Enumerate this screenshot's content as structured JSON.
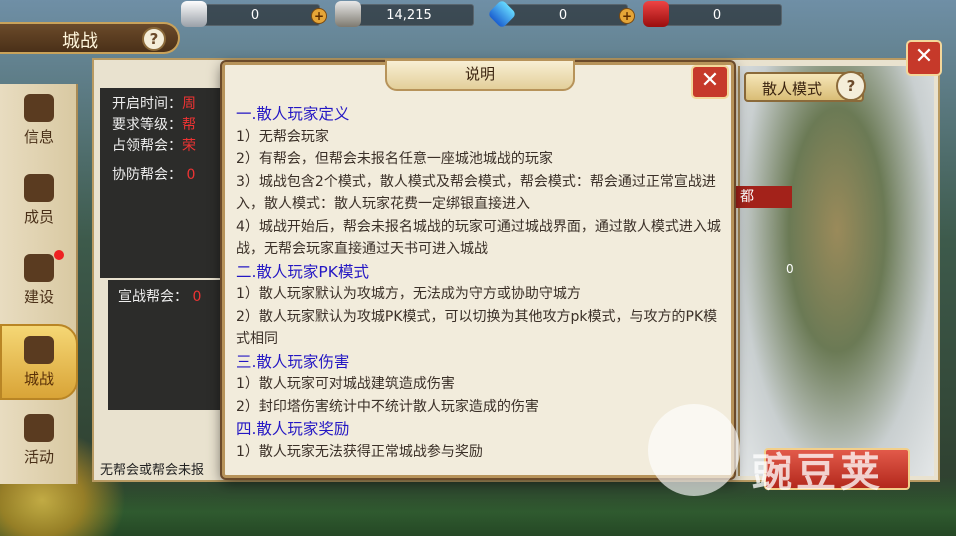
{
  "resources": [
    {
      "icon": "silver-ingot-icon",
      "value": "0",
      "has_plus": true
    },
    {
      "icon": "locked-ingot-icon",
      "value": "14,215",
      "has_plus": false
    },
    {
      "icon": "diamond-icon",
      "value": "0",
      "has_plus": true
    },
    {
      "icon": "fortune-ticket-icon",
      "value": "0",
      "has_plus": false
    }
  ],
  "header": {
    "title": "城战",
    "help": "?"
  },
  "sidebar": {
    "items": [
      {
        "label": "信息",
        "icon": "info-icon",
        "active": false
      },
      {
        "label": "成员",
        "icon": "members-icon",
        "active": false
      },
      {
        "label": "建设",
        "icon": "hammer-icon",
        "active": false,
        "badge": true
      },
      {
        "label": "城战",
        "icon": "castle-icon",
        "active": true
      },
      {
        "label": "活动",
        "icon": "flame-icon",
        "active": false
      }
    ]
  },
  "info": {
    "open_time_label": "开启时间：",
    "open_time_value": "周",
    "level_label": "要求等级：",
    "level_value": "帮",
    "occupy_label": "占领帮会：",
    "occupy_value": "荣",
    "defend_label": "协防帮会：",
    "defend_value": "0",
    "attack_label": "宣战帮会：",
    "attack_value": "0"
  },
  "bottom_text": "无帮会或帮会未报",
  "map": {
    "mode_label": "散人模式",
    "mode_help": "?",
    "city_name": "都",
    "city_count": "0"
  },
  "modal": {
    "title": "说明",
    "close": "✕",
    "sections": [
      {
        "heading": "一.散人玩家定义",
        "lines": [
          "1）无帮会玩家",
          "2）有帮会，但帮会未报名任意一座城池城战的玩家",
          "3）城战包含2个模式，散人模式及帮会模式，帮会模式：帮会通过正常宣战进入，散人模式：散人玩家花费一定绑银直接进入",
          "4）城战开始后，帮会未报名城战的玩家可通过城战界面，通过散人模式进入城战，无帮会玩家直接通过天书可进入城战"
        ]
      },
      {
        "heading": "二.散人玩家PK模式",
        "lines": [
          "1）散人玩家默认为攻城方，无法成为守方或协助守城方",
          "2）散人玩家默认为攻城PK模式，可以切换为其他攻方pk模式，与攻方的PK模式相同"
        ]
      },
      {
        "heading": "三.散人玩家伤害",
        "lines": [
          "1）散人玩家可对城战建筑造成伤害",
          "2）封印塔伤害统计中不统计散人玩家造成的伤害"
        ]
      },
      {
        "heading": "四.散人玩家奖励",
        "lines": [
          "1）散人玩家无法获得正常城战参与奖励"
        ]
      }
    ]
  },
  "watermark": {
    "text": "豌豆荚"
  }
}
